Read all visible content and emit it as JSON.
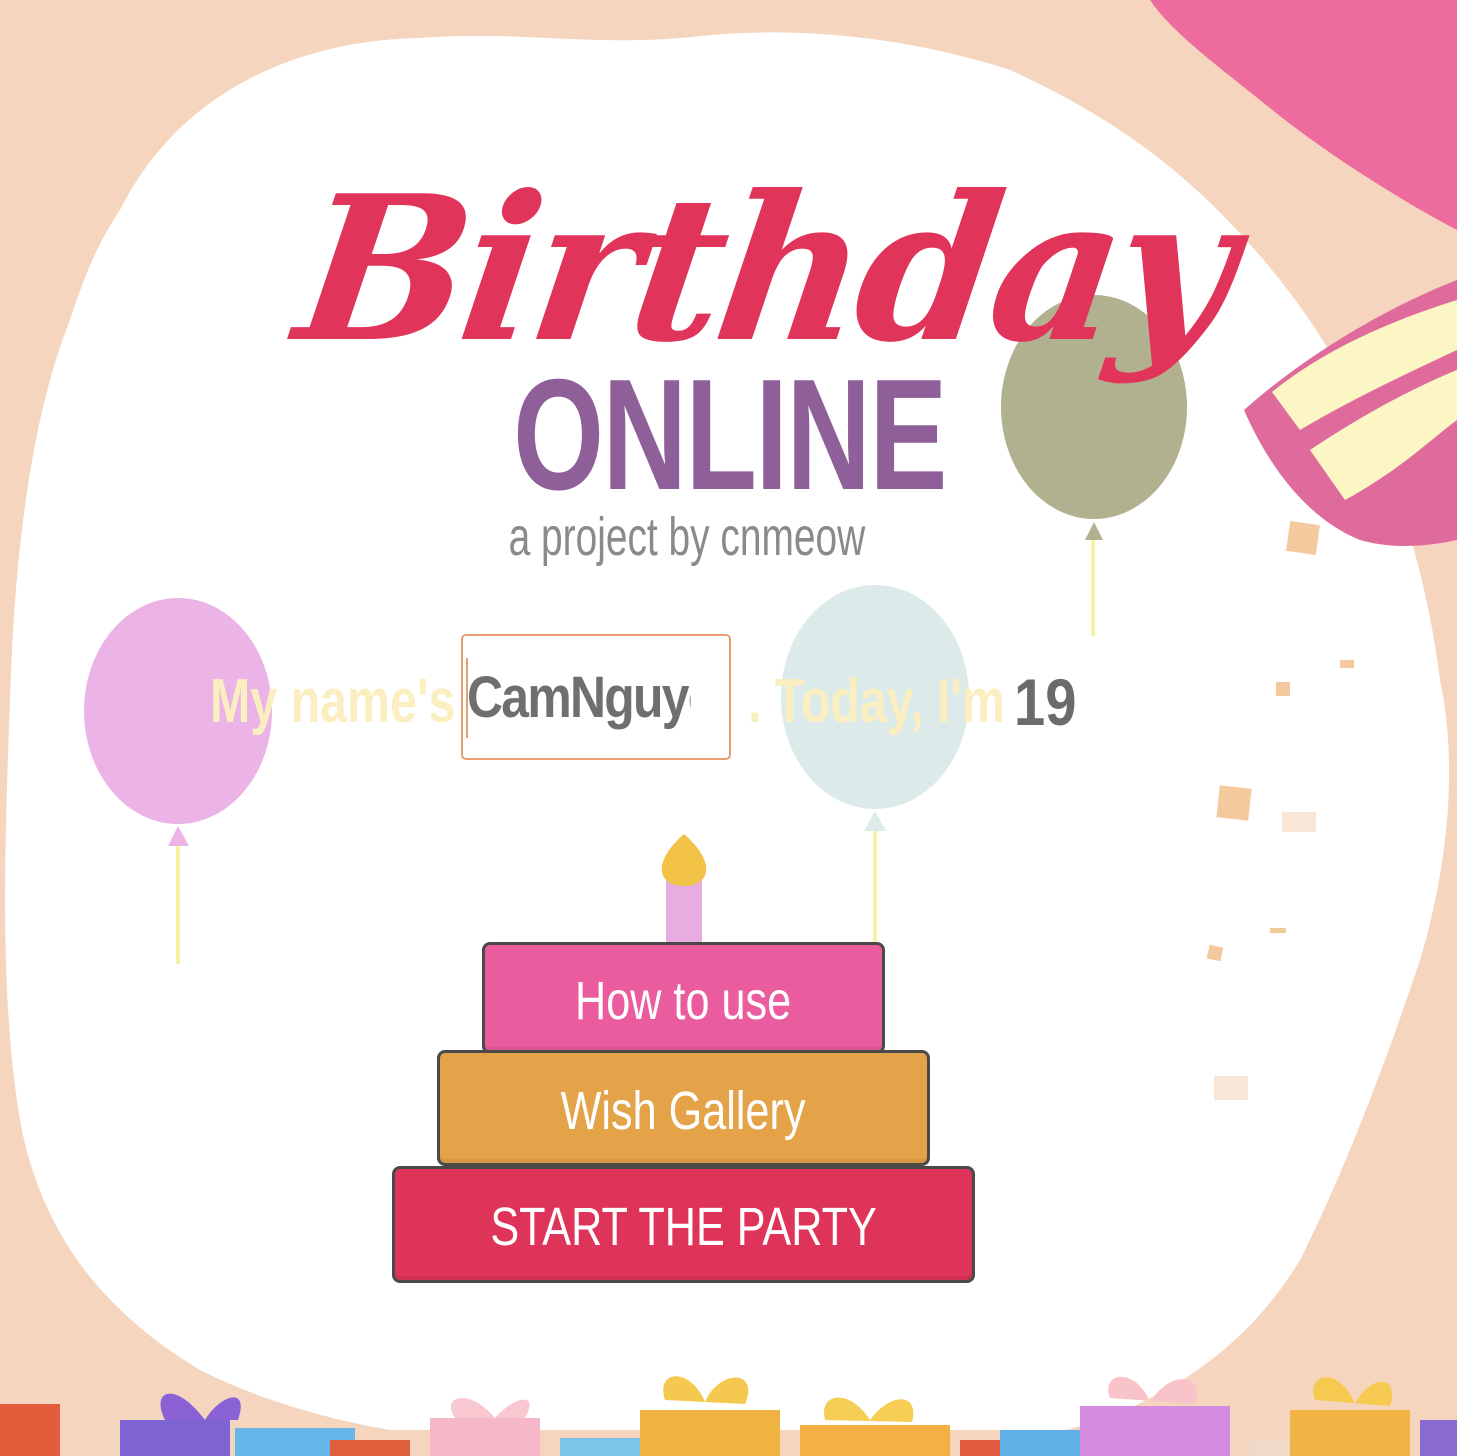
{
  "title": {
    "script": "Birthday",
    "main": "ONLINE",
    "subtitle": "a project by cnmeow"
  },
  "intro": {
    "name_prefix": "My name's",
    "name_value": "CamNguyen",
    "today_text": ". Today, I'm",
    "age_value": "19"
  },
  "buttons": {
    "how_to_use": "How to use",
    "wish_gallery": "Wish Gallery",
    "start_party": "START THE PARTY"
  },
  "colors": {
    "background_peach": "#f5d5bd",
    "title_red": "#e0345a",
    "title_purple": "#8e5f99",
    "button_pink": "#ea5c9d",
    "button_orange": "#e4a349",
    "button_red": "#de3459"
  }
}
